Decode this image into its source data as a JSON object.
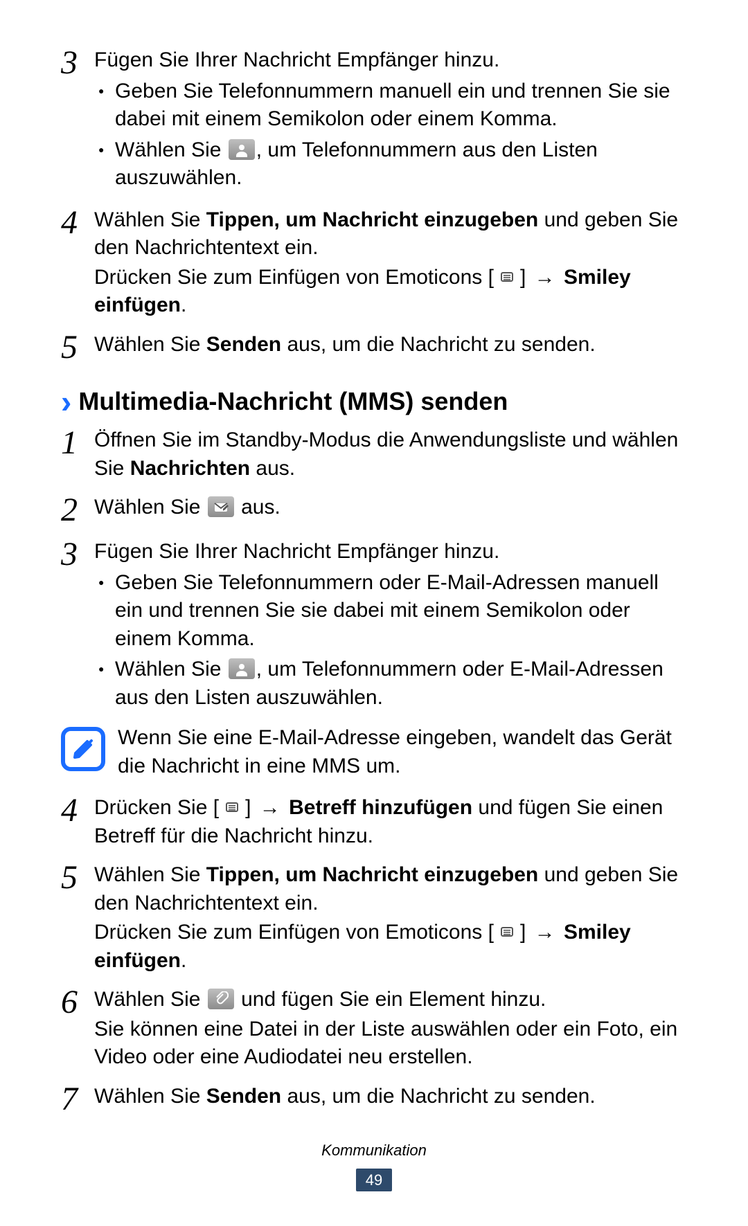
{
  "stepsTop": [
    {
      "num": "3",
      "lines": [
        "Fügen Sie Ihrer Nachricht Empfänger hinzu."
      ],
      "bullets": [
        {
          "pre": "Geben Sie Telefonnummern manuell ein und trennen Sie sie dabei mit einem Semikolon oder einem Komma."
        },
        {
          "pre": "Wählen Sie ",
          "icon": "contact",
          "post": ", um Telefonnummern aus den Listen auszuwählen."
        }
      ]
    },
    {
      "num": "4",
      "richLines": [
        {
          "parts": [
            {
              "t": "Wählen Sie "
            },
            {
              "t": "Tippen, um Nachricht einzugeben",
              "b": true
            },
            {
              "t": " und geben Sie den Nachrichtentext ein."
            }
          ]
        },
        {
          "parts": [
            {
              "t": "Drücken Sie zum Einfügen von Emoticons ["
            },
            {
              "icon": "menu"
            },
            {
              "t": "] "
            },
            {
              "t": "→",
              "cls": "arrow"
            },
            {
              "t": " "
            },
            {
              "t": "Smiley einfügen",
              "b": true
            },
            {
              "t": "."
            }
          ]
        }
      ]
    },
    {
      "num": "5",
      "richLines": [
        {
          "parts": [
            {
              "t": "Wählen Sie "
            },
            {
              "t": "Senden",
              "b": true
            },
            {
              "t": " aus, um die Nachricht zu senden."
            }
          ]
        }
      ]
    }
  ],
  "section": {
    "chevron": "›",
    "title": "Multimedia-Nachricht (MMS) senden"
  },
  "stepsMms": [
    {
      "num": "1",
      "richLines": [
        {
          "parts": [
            {
              "t": "Öffnen Sie im Standby-Modus die Anwendungsliste und wählen Sie "
            },
            {
              "t": "Nachrichten",
              "b": true
            },
            {
              "t": " aus."
            }
          ]
        }
      ]
    },
    {
      "num": "2",
      "richLines": [
        {
          "parts": [
            {
              "t": "Wählen Sie "
            },
            {
              "icon": "compose"
            },
            {
              "t": " aus."
            }
          ]
        }
      ]
    },
    {
      "num": "3",
      "lines": [
        "Fügen Sie Ihrer Nachricht Empfänger hinzu."
      ],
      "bullets": [
        {
          "pre": "Geben Sie Telefonnummern oder E-Mail-Adressen manuell ein und trennen Sie sie dabei mit einem Semikolon oder einem Komma."
        },
        {
          "pre": "Wählen Sie ",
          "icon": "contact",
          "post": ", um Telefonnummern oder E-Mail-Adressen aus den Listen auszuwählen."
        }
      ]
    }
  ],
  "note": "Wenn Sie eine E-Mail-Adresse eingeben, wandelt das Gerät die Nachricht in eine MMS um.",
  "stepsMms2": [
    {
      "num": "4",
      "richLines": [
        {
          "parts": [
            {
              "t": "Drücken Sie ["
            },
            {
              "icon": "menu"
            },
            {
              "t": "] "
            },
            {
              "t": "→",
              "cls": "arrow"
            },
            {
              "t": " "
            },
            {
              "t": "Betreff hinzufügen",
              "b": true
            },
            {
              "t": " und fügen Sie einen Betreff für die Nachricht hinzu."
            }
          ]
        }
      ]
    },
    {
      "num": "5",
      "richLines": [
        {
          "parts": [
            {
              "t": "Wählen Sie "
            },
            {
              "t": "Tippen, um Nachricht einzugeben",
              "b": true
            },
            {
              "t": " und geben Sie den Nachrichtentext ein."
            }
          ]
        },
        {
          "parts": [
            {
              "t": "Drücken Sie zum Einfügen von Emoticons ["
            },
            {
              "icon": "menu"
            },
            {
              "t": "] "
            },
            {
              "t": "→",
              "cls": "arrow"
            },
            {
              "t": " "
            },
            {
              "t": "Smiley einfügen",
              "b": true
            },
            {
              "t": "."
            }
          ]
        }
      ]
    },
    {
      "num": "6",
      "richLines": [
        {
          "parts": [
            {
              "t": "Wählen Sie "
            },
            {
              "icon": "attach"
            },
            {
              "t": " und fügen Sie ein Element hinzu."
            }
          ]
        },
        {
          "parts": [
            {
              "t": "Sie können eine Datei in der Liste auswählen oder ein Foto, ein Video oder eine Audiodatei neu erstellen."
            }
          ]
        }
      ]
    },
    {
      "num": "7",
      "richLines": [
        {
          "parts": [
            {
              "t": "Wählen Sie "
            },
            {
              "t": "Senden",
              "b": true
            },
            {
              "t": " aus, um die Nachricht zu senden."
            }
          ]
        }
      ]
    }
  ],
  "footer": {
    "section": "Kommunikation",
    "page": "49"
  },
  "bulletDot": "●"
}
